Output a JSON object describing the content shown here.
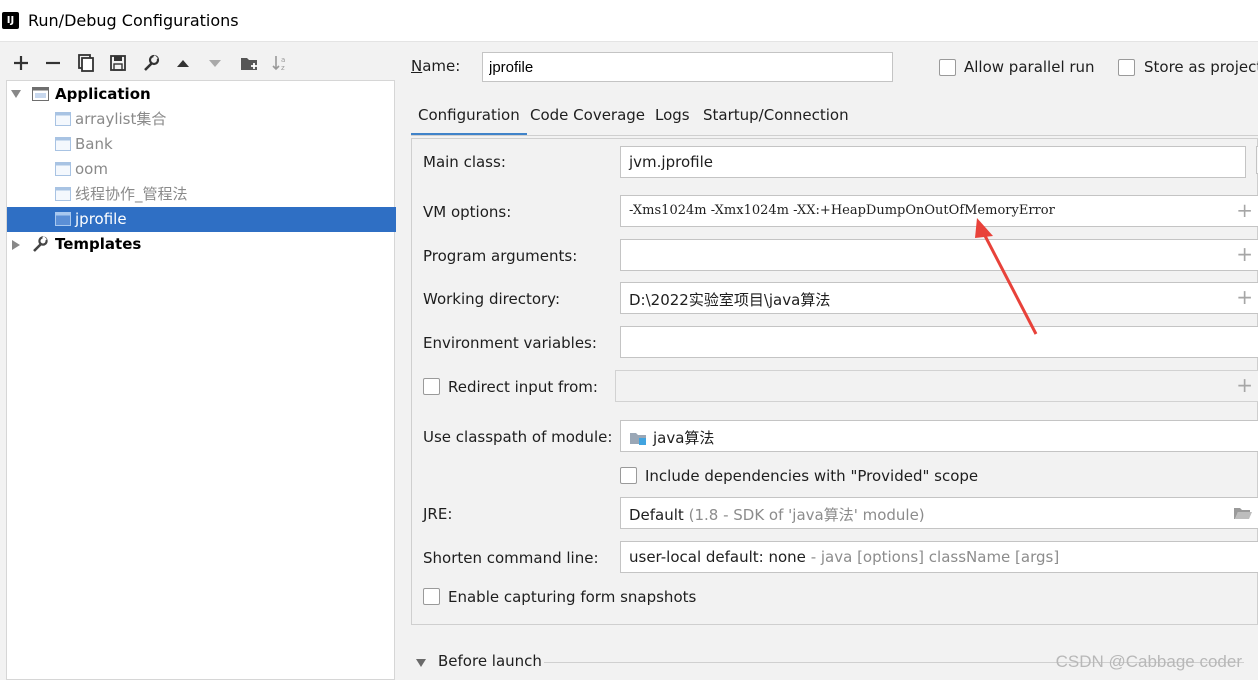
{
  "window": {
    "title": "Run/Debug Configurations",
    "logo_text": "IJ"
  },
  "toolbar": {
    "buttons": [
      "add-icon",
      "remove-icon",
      "copy-icon",
      "save-icon",
      "wrench-icon",
      "move-up-icon",
      "move-down-icon",
      "folder-add-icon",
      "sort-icon"
    ]
  },
  "tree": {
    "application": "Application",
    "items": [
      "arraylist集合",
      "Bank",
      "oom",
      "线程协作_管程法",
      "jprofile"
    ],
    "selected": "jprofile",
    "templates": "Templates"
  },
  "header": {
    "name_label": "Name:",
    "name_value": "jprofile",
    "allow_parallel": "Allow parallel run",
    "store_as_project": "Store as project"
  },
  "tabs": [
    "Configuration",
    "Code Coverage",
    "Logs",
    "Startup/Connection"
  ],
  "active_tab": "Configuration",
  "form": {
    "main_class_label": "Main class:",
    "main_class_value": "jvm.jprofile",
    "vm_options_label": "VM options:",
    "vm_options_value": "-Xms1024m -Xmx1024m -XX:+HeapDumpOnOutOfMemoryError",
    "program_args_label": "Program arguments:",
    "program_args_value": "",
    "working_dir_label": "Working directory:",
    "working_dir_value": "D:\\2022实验室项目\\java算法",
    "env_vars_label": "Environment variables:",
    "env_vars_value": "",
    "redirect_label": "Redirect input from:",
    "classpath_label": "Use classpath of module:",
    "classpath_value": "java算法",
    "include_deps_label": "Include dependencies with \"Provided\" scope",
    "jre_label": "JRE:",
    "jre_value": "Default",
    "jre_detail": "(1.8 - SDK of 'java算法' module)",
    "shorten_label": "Shorten command line:",
    "shorten_value": "user-local default: none",
    "shorten_detail": "- java [options] className [args]",
    "snapshots_label": "Enable capturing form snapshots"
  },
  "before_launch": "Before launch",
  "watermark": "CSDN @Cabbage coder",
  "colors": {
    "selection": "#2f6fc4",
    "tab_underline": "#4083c9",
    "annotation_arrow": "#e8423a"
  }
}
